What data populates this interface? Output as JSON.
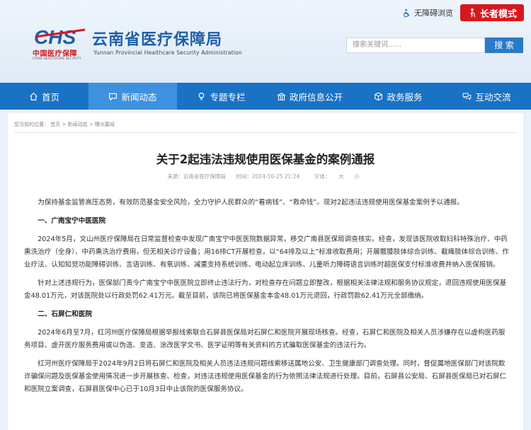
{
  "header": {
    "accessibility_label": "无障碍浏览",
    "elder_mode_label": "长者模式",
    "logo_subtitle_cn": "中国医疗保障",
    "logo_subtitle_en": "CHINA HEALTHCARE SECURITY",
    "site_title": "云南省医疗保障局",
    "site_title_en": "Yunnan Provincial Healthcare Security Administration",
    "search_placeholder": "搜索关键词......",
    "search_button": "搜 索"
  },
  "nav": {
    "items": [
      {
        "label": "首页",
        "icon": "home-icon"
      },
      {
        "label": "新闻动态",
        "icon": "chat-icon",
        "active": true
      },
      {
        "label": "专题专栏",
        "icon": "lightbulb-icon"
      },
      {
        "label": "政府信息公开",
        "icon": "building-icon"
      },
      {
        "label": "政务服务",
        "icon": "cube-icon"
      },
      {
        "label": "互动交流",
        "icon": "chat-bubbles-icon"
      }
    ]
  },
  "breadcrumb": {
    "prefix": "您当前的位置：",
    "home": "首页",
    "sep": ">",
    "section": "新闻动态",
    "current": "曝光要闻"
  },
  "article": {
    "title": "关于2起违法违规使用医保基金的案例通报",
    "source": "来源：云南省医疗保障局",
    "time": "时间：2024-10-25 21:24",
    "font_label": "字体：",
    "font_large": "大",
    "font_small": "小",
    "paragraphs": [
      "为保持基金监管高压态势，有效防范基金安全风险，全力守护人民群众的“看病钱”、“救命钱”。现对2起违法违规使用医保基金案例予以通报。",
      "一、广南宝宁中医医院",
      "2024年5月，文山州医疗保障局在日常监督检查中发现广南宝宁中医医院数据异常，移交广南县医保局调查核实。经查，发现该医院收取妇科特殊治疗、中药熏洗治疗（全身）、中药熏洗治疗费用，但无相关诊疗设备；用16排CT开展检查，以“64排及以上”标准收取费用；开展髋膝肢体综合训练、截瘫肢体综合训练、作业疗法、认知知觉功能障碍训练、言语训练、有氧训练、减重支持系统训练、电动起立床训练、儿童听力障碍语言训练时超医保支付标准收费并纳入医保报销。",
      "针对上述违规行为，医保部门责令广南宝宁中医医院立即终止违法行为，对检查存在问题立即整改，根据相关法律法规和服务协议规定，退回违规使用医保基金48.01万元，对该医院处以行政处罚62.41万元。截至目前，该院已将医保基金本金48.01万元退回，行政罚款62.41万元全部缴纳。",
      "二、石屏仁和医院",
      "2024年6月至7月，红河州医疗保障局根据举报线索联合石屏县医保局对石屏仁和医院开展现场核查。经查，石屏仁和医院及相关人员涉嫌存在以虚构医药服务项目、虚开医疗服务费用或以伪造、变造、涂改医学文书、医学证明等有关资料的方式骗取医保基金的违法行为。",
      "红河州医疗保障局于2024年9月2日将石屏仁和医院及相关人员违法违规问题线索移送属地公安、卫生健康部门调查处理。同时，督促属地医保部门对该院欺诈骗保问题及医保基金使用情况进一步开展核查、检查，对违法违规使用医保基金的行为依照法律法规进行处理。目前，石屏县公安局、石屏县医保局已对石屏仁和医院立案调查，石屏县医保中心已于10月3日中止该院的医保服务协议。"
    ]
  }
}
